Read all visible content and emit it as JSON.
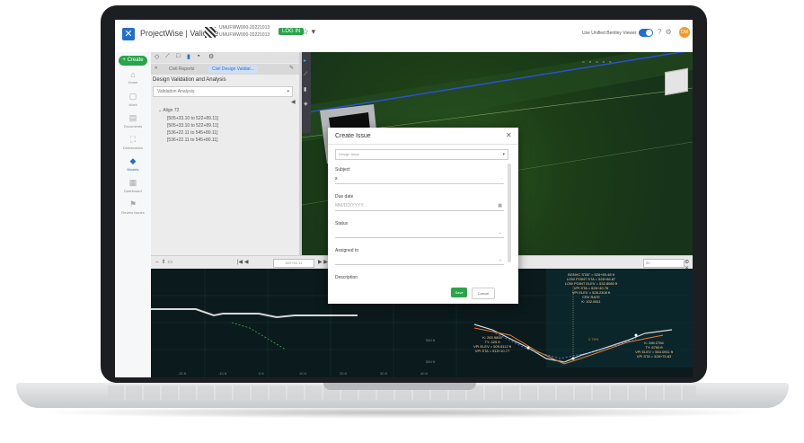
{
  "topbar": {
    "app_title": "ProjectWise | Validate",
    "project_line1": "UMUFWW000-20221013",
    "project_line2": "UMUFWW000-20221013",
    "badge": "LOG IN",
    "viewer_label": "Use Unified Bentley Viewer",
    "avatar": "DM"
  },
  "leftnav": {
    "create_label": "+ Create",
    "items": [
      {
        "label": "Home",
        "icon": "home-icon"
      },
      {
        "label": "Work",
        "icon": "work-icon"
      },
      {
        "label": "Documents",
        "icon": "documents-icon"
      },
      {
        "label": "Deliverables",
        "icon": "deliverables-icon"
      },
      {
        "label": "Models",
        "icon": "models-icon",
        "active": true
      },
      {
        "label": "Dashboard",
        "icon": "dashboard-icon"
      },
      {
        "label": "Review issues",
        "icon": "issues-icon"
      }
    ]
  },
  "panel": {
    "tabs": [
      "Civil Reports",
      "Civil Design Validat..."
    ],
    "title": "Design Validation and Analysis",
    "select_value": "Validation Analysis",
    "tree_root": "Align 72",
    "tree_items": [
      "[505+33.10 to 522+89.11]",
      "[505+33.10 to 522+89.11]",
      "[536+22.11 to 545+80.11]",
      "[536+22.11 to 545+80.11]"
    ]
  },
  "bottombar": {
    "station": "522+01.11",
    "right_value": "50"
  },
  "profile": {
    "annotations": [
      "BGNVC STAT = 526+89.48 ft\nLOW POINT STA = 526+86.87\nLOW POINT ELEV = 532.8080 ft\nVPI STA = 526+40.76\nVPI ELEV = 528.2308 ft\nCRV RATE\nK: 102.0811",
      "K: 263.9800\nTY: 425 ft\nVPI ELEV = 509.8112 ft\nVPI STA = 515+10.77",
      "K: 285.2784\nTY: 6760 ft\nVPI ELEV = 564.0911 ft\nVPI STA = 528+75.83"
    ],
    "grade_label": "2.75%",
    "y_ticks": [
      "560 ft",
      "550 ft"
    ],
    "x_ticks": [
      "-20 ft",
      "-10 ft",
      "0 ft",
      "10 ft",
      "20 ft",
      "30 ft",
      "40 ft"
    ]
  },
  "modal": {
    "title": "Create Issue",
    "type_placeholder": "Design Issue",
    "subject_label": "Subject",
    "subject_value": "s",
    "due_date_label": "Due date",
    "due_date_placeholder": "MM/DD/YYYY",
    "status_label": "Status",
    "assigned_label": "Assigned to",
    "description_label": "Description",
    "save_label": "Save",
    "cancel_label": "Cancel"
  }
}
